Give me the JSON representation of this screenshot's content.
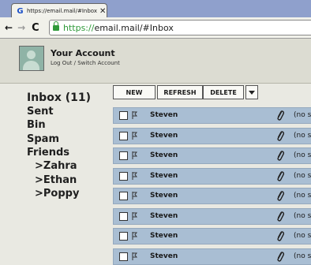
{
  "browser": {
    "tab_title": "https://email.mail/#Inbox",
    "tab_close": "✕",
    "url_scheme": "https://",
    "url_rest": "email.mail/#Inbox",
    "back": "←",
    "forward": "→",
    "reload": "C"
  },
  "account": {
    "name": "Your Account",
    "links": "Log Out / Switch Account"
  },
  "sidebar": {
    "folders": [
      {
        "label": "Inbox (11)"
      },
      {
        "label": "Sent"
      },
      {
        "label": "Bin"
      },
      {
        "label": "Spam"
      },
      {
        "label": "Friends"
      },
      {
        "label": ">Zahra"
      },
      {
        "label": ">Ethan"
      },
      {
        "label": ">Poppy"
      }
    ]
  },
  "actions": {
    "new": "NEW",
    "refresh": "REFRESH",
    "delete": "DELETE"
  },
  "messages": [
    {
      "sender": "Steven",
      "subject": "(no s"
    },
    {
      "sender": "Steven",
      "subject": "(no s"
    },
    {
      "sender": "Steven",
      "subject": "(no s"
    },
    {
      "sender": "Steven",
      "subject": "(no s"
    },
    {
      "sender": "Steven",
      "subject": "(no s"
    },
    {
      "sender": "Steven",
      "subject": "(no s"
    },
    {
      "sender": "Steven",
      "subject": "(no s"
    },
    {
      "sender": "Steven",
      "subject": "(no s"
    }
  ],
  "colors": {
    "tab_strip": "#8fa0cc",
    "row_bg": "#a9bed3",
    "secure_green": "#2f9a3a"
  }
}
